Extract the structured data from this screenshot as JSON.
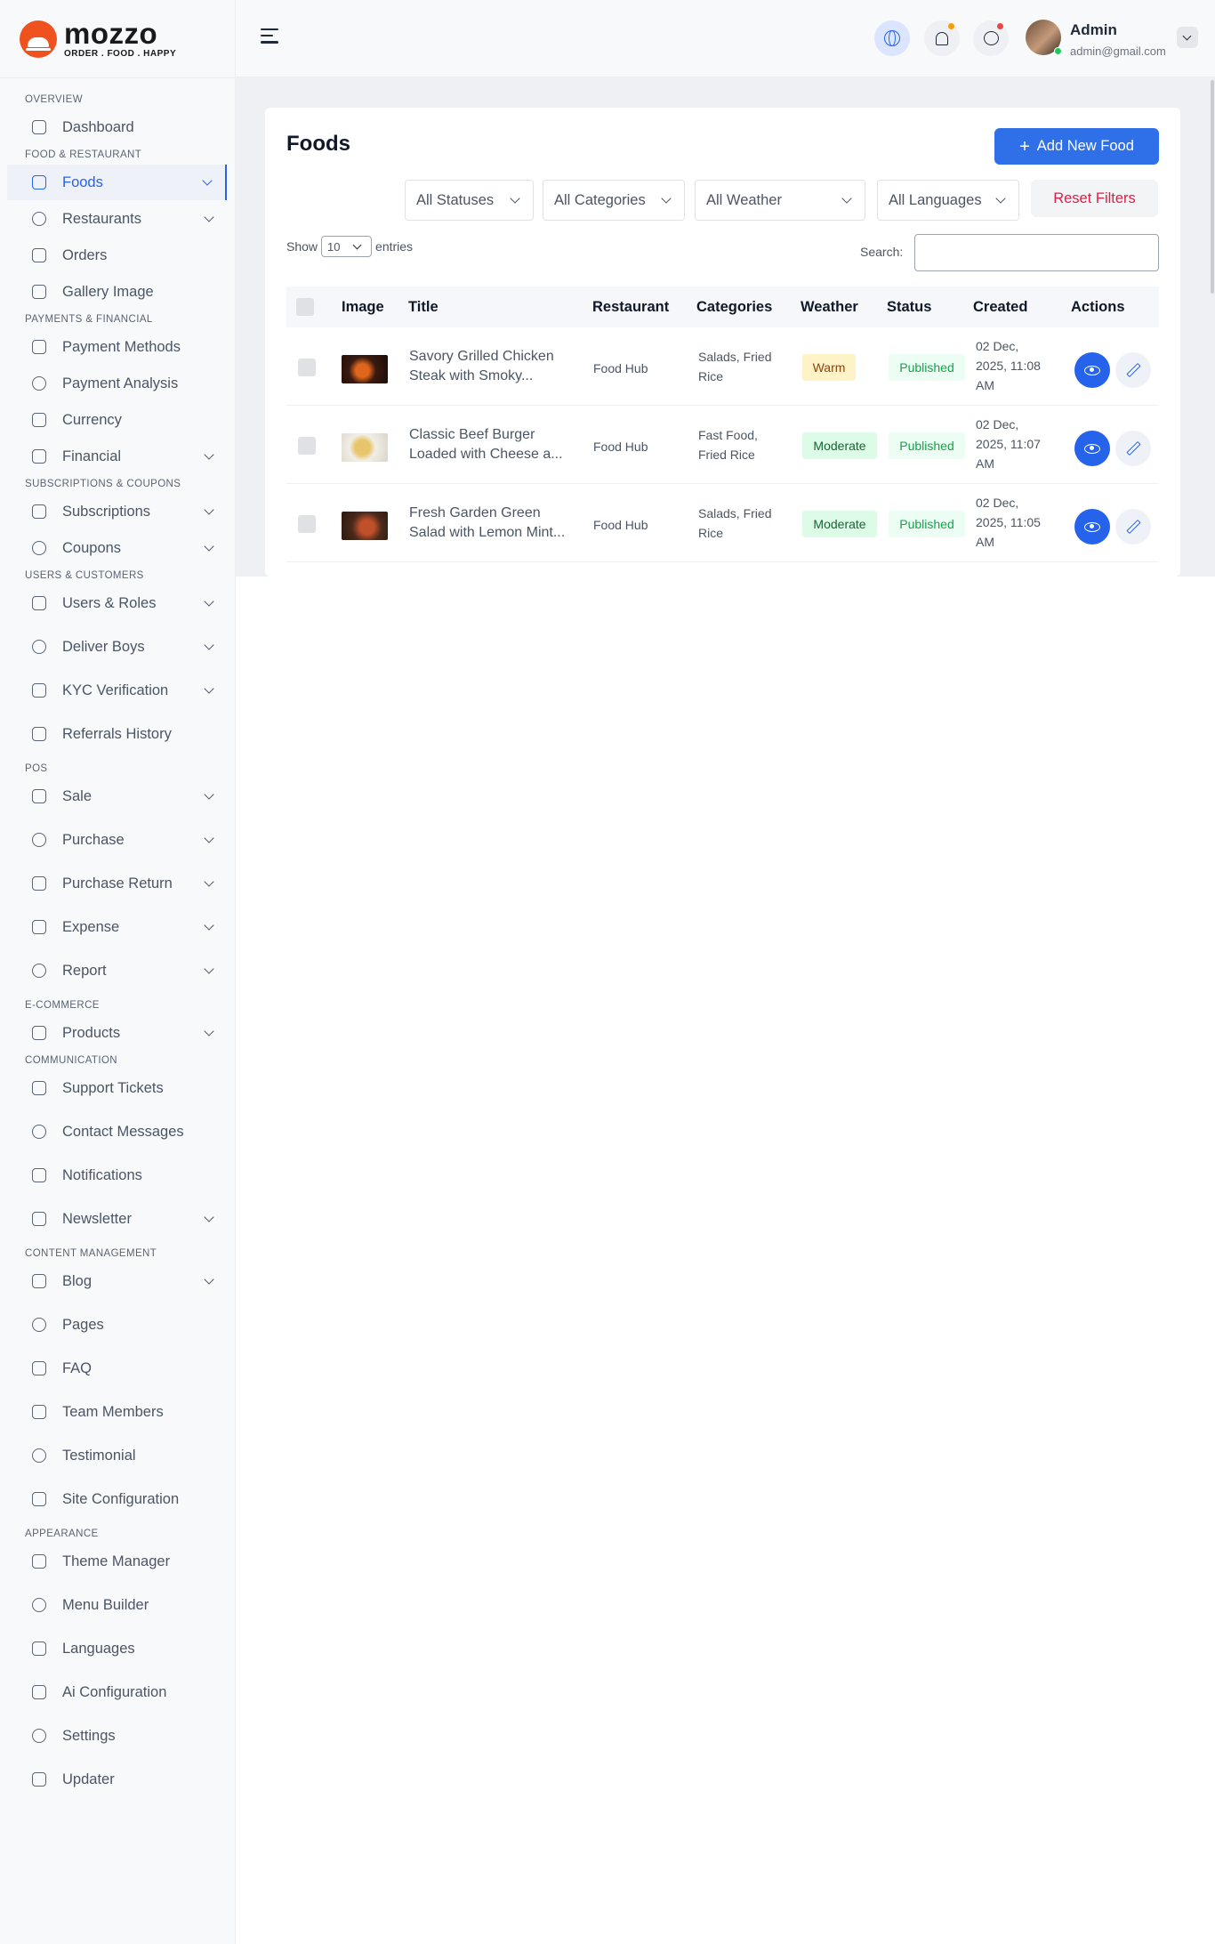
{
  "brand": {
    "name": "mozzo",
    "tagline": "ORDER . FOOD . HAPPY"
  },
  "sidebar": {
    "sections": [
      {
        "title": "OVERVIEW",
        "items": [
          {
            "label": "Dashboard",
            "chevron": false
          }
        ]
      },
      {
        "title": "FOOD & RESTAURANT",
        "items": [
          {
            "label": "Foods",
            "chevron": true,
            "active": true
          },
          {
            "label": "Restaurants",
            "chevron": true
          },
          {
            "label": "Orders",
            "chevron": false
          },
          {
            "label": "Gallery Image",
            "chevron": false
          }
        ]
      },
      {
        "title": "PAYMENTS & FINANCIAL",
        "items": [
          {
            "label": "Payment Methods",
            "chevron": false
          },
          {
            "label": "Payment Analysis",
            "chevron": false
          },
          {
            "label": "Currency",
            "chevron": false
          },
          {
            "label": "Financial",
            "chevron": true
          }
        ]
      },
      {
        "title": "SUBSCRIPTIONS & COUPONS",
        "items": [
          {
            "label": "Subscriptions",
            "chevron": true
          },
          {
            "label": "Coupons",
            "chevron": true
          }
        ]
      },
      {
        "title": "USERS & CUSTOMERS",
        "items": [
          {
            "label": "Users & Roles",
            "chevron": true
          },
          {
            "label": "Deliver Boys",
            "chevron": true
          },
          {
            "label": "KYC Verification",
            "chevron": true
          },
          {
            "label": "Referrals History",
            "chevron": false
          }
        ]
      },
      {
        "title": "POS",
        "items": [
          {
            "label": "Sale",
            "chevron": true
          },
          {
            "label": "Purchase",
            "chevron": true
          },
          {
            "label": "Purchase Return",
            "chevron": true
          },
          {
            "label": "Expense",
            "chevron": true
          },
          {
            "label": "Report",
            "chevron": true
          }
        ]
      },
      {
        "title": "E-COMMERCE",
        "items": [
          {
            "label": "Products",
            "chevron": true
          }
        ]
      },
      {
        "title": "COMMUNICATION",
        "items": [
          {
            "label": "Support Tickets",
            "chevron": false
          },
          {
            "label": "Contact Messages",
            "chevron": false
          },
          {
            "label": "Notifications",
            "chevron": false
          },
          {
            "label": "Newsletter",
            "chevron": true
          }
        ]
      },
      {
        "title": "CONTENT MANAGEMENT",
        "items": [
          {
            "label": "Blog",
            "chevron": true
          },
          {
            "label": "Pages",
            "chevron": false
          },
          {
            "label": "FAQ",
            "chevron": false
          },
          {
            "label": "Team Members",
            "chevron": false
          },
          {
            "label": "Testimonial",
            "chevron": false
          },
          {
            "label": "Site Configuration",
            "chevron": false
          }
        ]
      },
      {
        "title": "APPEARANCE",
        "items": [
          {
            "label": "Theme Manager",
            "chevron": false
          },
          {
            "label": "Menu Builder",
            "chevron": false
          },
          {
            "label": "Languages",
            "chevron": false
          },
          {
            "label": "Ai Configuration",
            "chevron": false
          },
          {
            "label": "Settings",
            "chevron": false
          },
          {
            "label": "Updater",
            "chevron": false
          }
        ]
      }
    ]
  },
  "header": {
    "user_name": "Admin",
    "user_email": "admin@gmail.com",
    "icons": [
      "menu-icon",
      "globe-icon",
      "bell-icon",
      "chat-icon"
    ]
  },
  "page": {
    "title": "Foods",
    "add_button": "Add New Food",
    "filters": [
      "All Statuses",
      "All Categories",
      "All Weather",
      "All Languages"
    ],
    "reset_button": "Reset Filters",
    "show_label": "Show",
    "entries_value": "10",
    "entries_label": "entries",
    "search_label": "Search:",
    "search_value": ""
  },
  "table": {
    "columns": [
      "Image",
      "Title",
      "Restaurant",
      "Categories",
      "Weather",
      "Status",
      "Created",
      "Actions"
    ],
    "rows": [
      {
        "title": "Savory Grilled Chicken Steak with Smoky...",
        "restaurant": "Food Hub",
        "categories": "Salads, Fried Rice",
        "weather": "Warm",
        "status": "Published",
        "created": "02 Dec, 2025, 11:08 AM"
      },
      {
        "title": "Classic Beef Burger Loaded with Cheese a...",
        "restaurant": "Food Hub",
        "categories": "Fast Food, Fried Rice",
        "weather": "Moderate",
        "status": "Published",
        "created": "02 Dec, 2025, 11:07 AM"
      },
      {
        "title": "Fresh Garden Green Salad with Lemon Mint...",
        "restaurant": "Food Hub",
        "categories": "Salads, Fried Rice",
        "weather": "Moderate",
        "status": "Published",
        "created": "02 Dec, 2025, 11:05 AM"
      }
    ]
  },
  "colors": {
    "accent": "#2563eb",
    "primary_button": "#2f6fe8",
    "reset_text": "#e11d48",
    "warm_bg": "#fef3c7",
    "warm_text": "#92400e",
    "moderate_bg": "#dcfce7",
    "moderate_text": "#166534",
    "published_bg": "#ecfdf3",
    "published_text": "#16a34a"
  }
}
